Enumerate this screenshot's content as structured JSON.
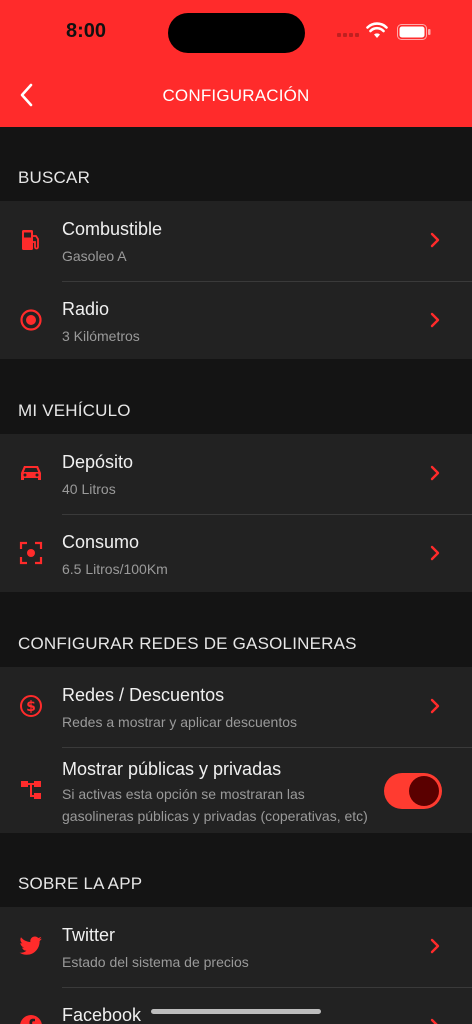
{
  "status_bar": {
    "time": "8:00"
  },
  "nav": {
    "title": "CONFIGURACIÓN",
    "back_icon": "chevron-left-icon"
  },
  "colors": {
    "accent": "#ff2b2b",
    "background": "#141414",
    "row_bg": "#222222",
    "toggle_on": "#ff3b30"
  },
  "sections": {
    "buscar": {
      "header": "BUSCAR",
      "rows": [
        {
          "icon": "fuel-pump-icon",
          "title": "Combustible",
          "subtitle": "Gasoleo A"
        },
        {
          "icon": "target-icon",
          "title": "Radio",
          "subtitle": "3 Kilómetros"
        }
      ]
    },
    "vehiculo": {
      "header": "MI VEHÍCULO",
      "rows": [
        {
          "icon": "car-icon",
          "title": "Depósito",
          "subtitle": "40 Litros"
        },
        {
          "icon": "focus-icon",
          "title": "Consumo",
          "subtitle": "6.5 Litros/100Km"
        }
      ]
    },
    "redes": {
      "header": "CONFIGURAR REDES DE GASOLINERAS",
      "rows": [
        {
          "icon": "dollar-circle-icon",
          "title": "Redes / Descuentos",
          "subtitle": "Redes a mostrar y aplicar descuentos"
        },
        {
          "icon": "network-icon",
          "title": "Mostrar públicas y privadas",
          "subtitle": "Si activas esta opción se mostraran las gasolineras públicas y privadas (coperativas, etc)",
          "toggle_on": true
        }
      ]
    },
    "app": {
      "header": "SOBRE LA APP",
      "rows": [
        {
          "icon": "twitter-icon",
          "title": "Twitter",
          "subtitle": "Estado del sistema de precios"
        },
        {
          "icon": "facebook-icon",
          "title": "Facebook"
        }
      ]
    }
  }
}
